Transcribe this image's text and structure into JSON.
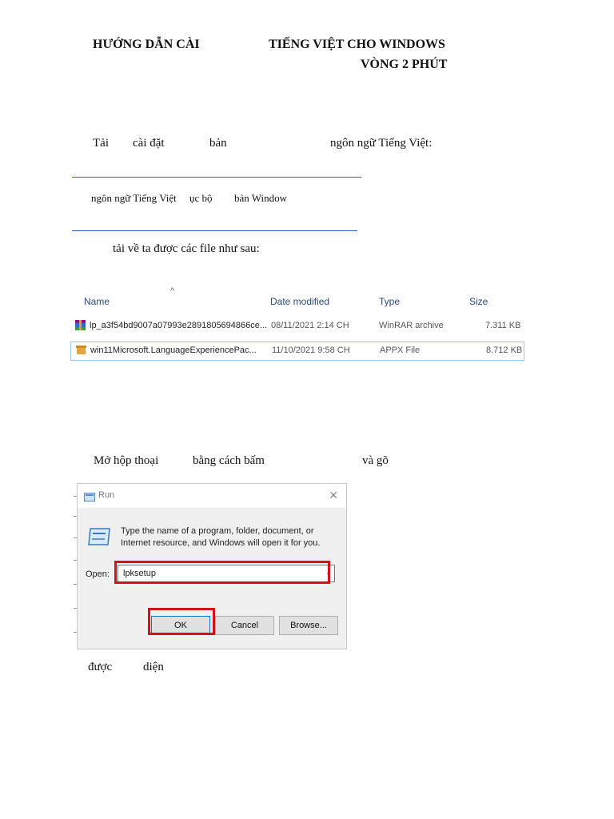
{
  "heading": {
    "line1_left": "HƯỚNG DẪN CÀI",
    "line1_right": "TIẾNG VIỆT CHO WINDOWS",
    "line2": "VÒNG 2 PHÚT"
  },
  "step1": {
    "w1": "Tải",
    "w2": "cài đặt",
    "w3": "bản",
    "w4": "ngôn ngữ Tiếng Việt:"
  },
  "link_text": {
    "part1": "ngôn ngữ Tiếng Việt",
    "part2": "ục bộ",
    "part3": "bản Window"
  },
  "after_download": "tải về ta được các file như sau:",
  "explorer": {
    "sort_glyph": "^",
    "columns": [
      "Name",
      "Date modified",
      "Type",
      "Size"
    ],
    "rows": [
      {
        "name": "lp_a3f54bd9007a07993e2891805694866ce...",
        "date": "08/11/2021 2:14 CH",
        "type": "WinRAR archive",
        "size": "7.311 KB",
        "icon": "winrar-archive-icon"
      },
      {
        "name": "win11Microsoft.LanguageExperiencePac...",
        "date": "11/10/2021 9:58 CH",
        "type": "APPX File",
        "size": "8.712 KB",
        "icon": "appx-package-icon"
      }
    ]
  },
  "step2": {
    "w1": "Mở hộp thoại",
    "w2": "bằng cách bấm",
    "w3": "và gõ"
  },
  "run_dialog": {
    "title": "Run",
    "close_glyph": "✕",
    "description": "Type the name of a program, folder, document, or Internet resource, and Windows will open it for you.",
    "open_label": "Open:",
    "open_value": "lpksetup",
    "ok_label": "OK",
    "cancel_label": "Cancel",
    "browse_label": "Browse...",
    "highlight_color": "#d0121b"
  },
  "footer": {
    "w1": "được",
    "w2": "diện"
  }
}
